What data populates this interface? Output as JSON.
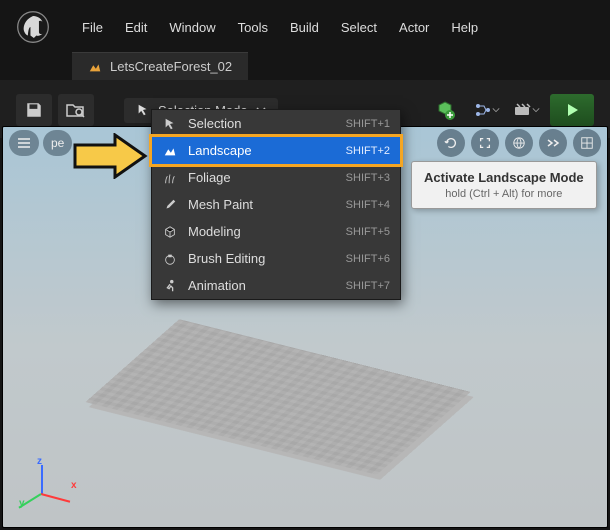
{
  "menubar": {
    "items": [
      "File",
      "Edit",
      "Window",
      "Tools",
      "Build",
      "Select",
      "Actor",
      "Help"
    ]
  },
  "tab": {
    "title": "LetsCreateForest_02"
  },
  "toolbar": {
    "save_label": "Save",
    "browse_label": "Browse",
    "selection_mode_label": "Selection Mode"
  },
  "viewport": {
    "mode_label": "Perspective"
  },
  "gizmo": {
    "x": "x",
    "y": "y",
    "z": "z"
  },
  "mode_dropdown": {
    "items": [
      {
        "icon": "cursor",
        "label": "Selection",
        "shortcut": "SHIFT+1",
        "highlight": false
      },
      {
        "icon": "mountain",
        "label": "Landscape",
        "shortcut": "SHIFT+2",
        "highlight": true
      },
      {
        "icon": "grass",
        "label": "Foliage",
        "shortcut": "SHIFT+3",
        "highlight": false
      },
      {
        "icon": "brush",
        "label": "Mesh Paint",
        "shortcut": "SHIFT+4",
        "highlight": false
      },
      {
        "icon": "cubes",
        "label": "Modeling",
        "shortcut": "SHIFT+5",
        "highlight": false
      },
      {
        "icon": "circle",
        "label": "Brush Editing",
        "shortcut": "SHIFT+6",
        "highlight": false
      },
      {
        "icon": "running",
        "label": "Animation",
        "shortcut": "SHIFT+7",
        "highlight": false
      }
    ]
  },
  "tooltip": {
    "title": "Activate Landscape Mode",
    "sub": "hold (Ctrl + Alt) for more"
  }
}
